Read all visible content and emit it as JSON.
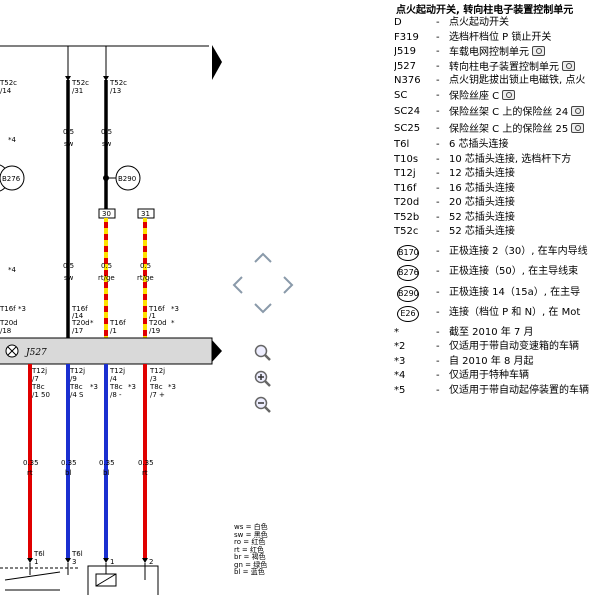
{
  "legend": {
    "title": "点火起动开关, 转向柱电子装置控制单元",
    "items": [
      {
        "code": "D",
        "desc": "点火起动开关",
        "cam": false
      },
      {
        "code": "F319",
        "desc": "选档杆档位 P 锁止开关",
        "cam": false
      },
      {
        "code": "J519",
        "desc": "车载电网控制单元",
        "cam": true
      },
      {
        "code": "J527",
        "desc": "转向柱电子装置控制单元",
        "cam": true
      },
      {
        "code": "N376",
        "desc": "点火钥匙拔出锁止电磁铁, 点火",
        "cam": false
      },
      {
        "code": "SC",
        "desc": "保险丝座 C",
        "cam": true
      },
      {
        "code": "SC24",
        "desc": "保险丝架 C 上的保险丝 24",
        "cam": true
      },
      {
        "code": "SC25",
        "desc": "保险丝架 C 上的保险丝 25",
        "cam": true
      },
      {
        "code": "T6l",
        "desc": "6 芯插头连接",
        "cam": false
      },
      {
        "code": "T10s",
        "desc": "10 芯插头连接, 选档杆下方",
        "cam": false
      },
      {
        "code": "T12j",
        "desc": "12 芯插头连接",
        "cam": false
      },
      {
        "code": "T16f",
        "desc": "16 芯插头连接",
        "cam": false
      },
      {
        "code": "T20d",
        "desc": "20 芯插头连接",
        "cam": false
      },
      {
        "code": "T52b",
        "desc": "52 芯插头连接",
        "cam": false
      },
      {
        "code": "T52c",
        "desc": "52 芯插头连接",
        "cam": false
      }
    ],
    "circles": [
      {
        "code": "B170",
        "desc": "正极连接 2（30）, 在车内导线"
      },
      {
        "code": "B276",
        "desc": "正极连接（50）, 在主导线束"
      },
      {
        "code": "B290",
        "desc": "正极连接 14（15a）, 在主导"
      },
      {
        "code": "E26",
        "desc": "连接（档位 P 和 N）, 在 Mot"
      }
    ],
    "notes": [
      {
        "code": "*",
        "desc": "截至 2010 年 7 月"
      },
      {
        "code": "*2",
        "desc": "仅适用于带自动变速箱的车辆"
      },
      {
        "code": "*3",
        "desc": "自 2010 年 8 月起"
      },
      {
        "code": "*4",
        "desc": "仅适用于特种车辆"
      },
      {
        "code": "*5",
        "desc": "仅适用于带自动起停装置的车辆"
      }
    ]
  },
  "colors": [
    "ws = 白色",
    "sw = 黑色",
    "ro = 红色",
    "rt = 红色",
    "br = 褐色",
    "gn = 绿色",
    "bl = 蓝色"
  ],
  "diagram": {
    "component_label": "J527",
    "fuse_30": "30",
    "fuse_31": "31",
    "conn_B276": "B276",
    "conn_B290": "B290",
    "top_T52c_a": "T52c",
    "top_T52c_a_pin": "/31",
    "top_T52c_b": "T52c",
    "top_T52c_b_pin": "/13",
    "left_T52c": "T52c",
    "left_T52c_pin": "/14",
    "left_star4_a": "*4",
    "left_star4_b": "*4",
    "wire_05": "0.5",
    "wire_sw": "sw",
    "wire_rtge": "rt/ge",
    "wire_035": "0.35",
    "wire_rt": "rt",
    "wire_bl": "bl",
    "t16f": "T16f",
    "t20d": "T20d",
    "t12j": "T12j",
    "t8c": "T8c",
    "t6l": "T6l",
    "star3": "*3",
    "star": "*",
    "p_14": "/14",
    "p_17": "/17",
    "p_1": "/1",
    "p_19": "/19",
    "p_18": "/18",
    "p_7": "/7",
    "p_9": "/9",
    "p_4": "/4",
    "p_3": "/3",
    "p_150": "/1 50",
    "p_4s": "/4 S",
    "p_8": "/8 -",
    "p_7p": "/7 +",
    "p_s5": "/1",
    "p_3b": "3",
    "p_1b": "1",
    "p_2b": "2"
  }
}
